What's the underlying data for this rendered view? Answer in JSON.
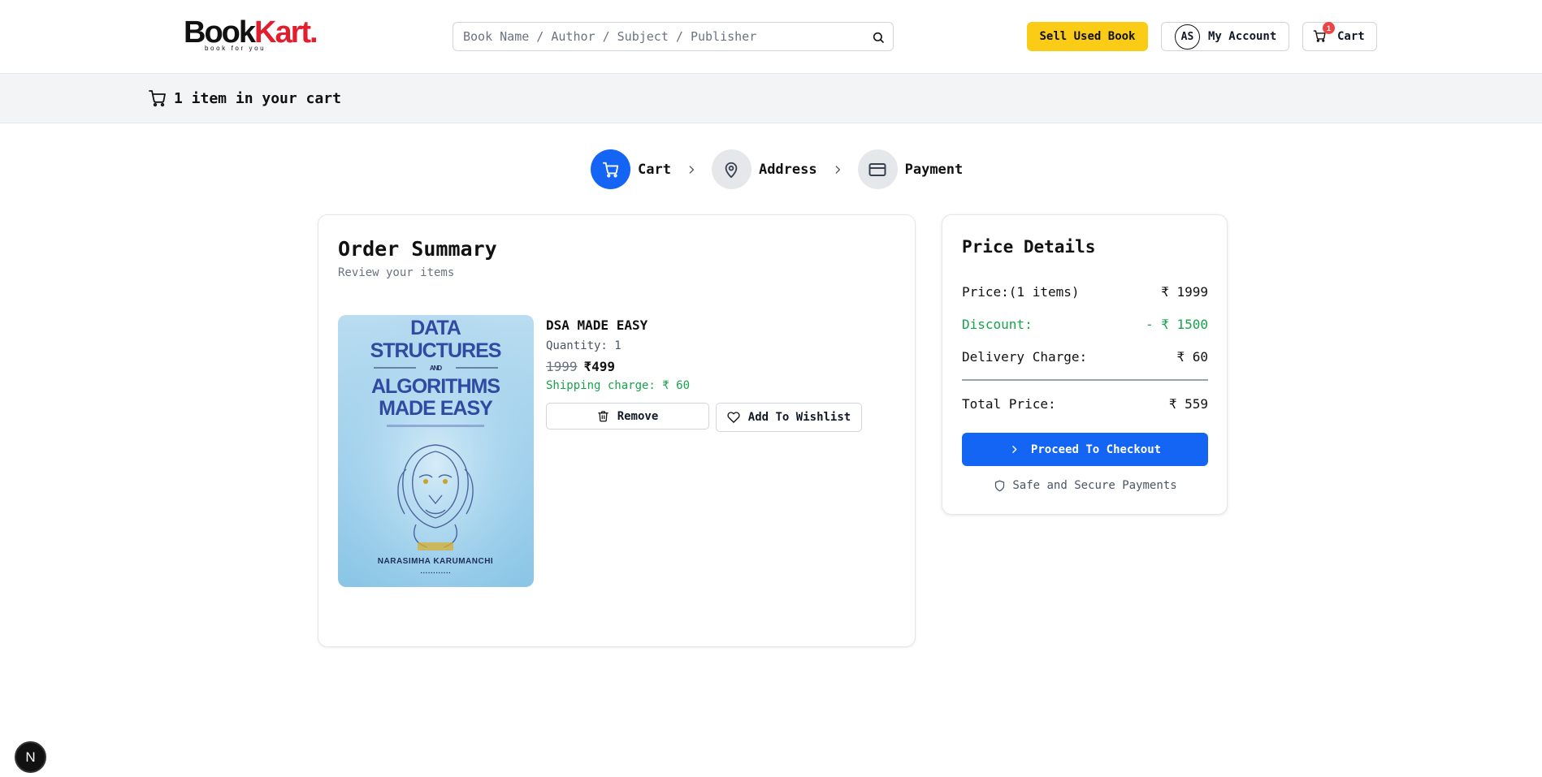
{
  "header": {
    "logo": {
      "book": "Book",
      "kart": "Kart.",
      "tagline": "book for you"
    },
    "search": {
      "placeholder": "Book Name / Author / Subject / Publisher"
    },
    "sell_label": "Sell Used Book",
    "account": {
      "initials": "AS",
      "label": "My Account"
    },
    "cart": {
      "label": "Cart",
      "count": "1"
    }
  },
  "banner": {
    "text": "1 item in your cart"
  },
  "steps": [
    {
      "label": "Cart",
      "active": true
    },
    {
      "label": "Address",
      "active": false
    },
    {
      "label": "Payment",
      "active": false
    }
  ],
  "order": {
    "title": "Order Summary",
    "subtitle": "Review your items",
    "item": {
      "title": "DSA MADE EASY",
      "quantity": "Quantity: 1",
      "original_price": "1999",
      "price": "₹499",
      "shipping": "Shipping charge: ₹ 60",
      "cover": {
        "line1": "DATA",
        "line2": "STRUCTURES",
        "and": "AND",
        "line3": "ALGORITHMS",
        "line4": "MADE EASY",
        "author": "NARASIMHA KARUMANCHI"
      },
      "remove_label": "Remove",
      "wishlist_label": "Add To Wishlist"
    }
  },
  "price_details": {
    "title": "Price Details",
    "rows": [
      {
        "label": "Price:(1 items)",
        "value": "₹ 1999"
      },
      {
        "label": "Discount:",
        "value": "- ₹ 1500"
      },
      {
        "label": "Delivery Charge:",
        "value": "₹ 60"
      }
    ],
    "total": {
      "label": "Total Price:",
      "value": "₹ 559"
    },
    "checkout_label": "Proceed To Checkout",
    "secure_label": "Safe and Secure Payments"
  },
  "dev_badge": "N",
  "colors": {
    "primary": "#1565f5",
    "accent": "#facc15",
    "brand_red": "#e11d2e",
    "discount": "#16a34a"
  }
}
